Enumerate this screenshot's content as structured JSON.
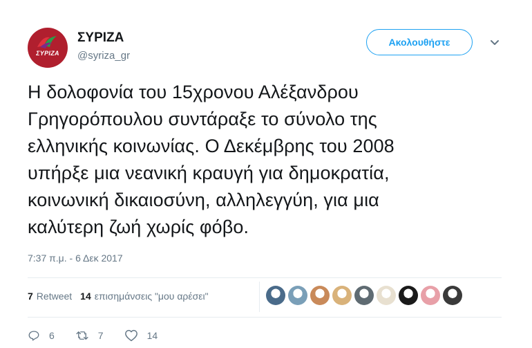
{
  "profile": {
    "name": "ΣΥΡΙΖΑ",
    "handle": "@syriza_gr",
    "avatar_text": "ΣΥΡΙΖΑ"
  },
  "follow_label": "Ακολουθήστε",
  "tweet_text": "Η δολοφονία του 15χρονου Αλέξανδρου\nΓρηγορόπουλου συντάραξε το σύνολο της\nελληνικής κοινωνίας. Ο Δεκέμβρης του 2008\nυπήρξε μια νεανική κραυγή για δημοκρατία,\nκοινωνική δικαιοσύνη, αλληλεγγύη, για μια\nκαλύτερη ζωή χωρίς φόβο.",
  "timestamp": "7:37 π.μ. - 6 Δεκ 2017",
  "stats": {
    "retweets_count": "7",
    "retweets_label": "Retweet",
    "likes_count": "14",
    "likes_label": "επισημάνσεις \"μου αρέσει\""
  },
  "likers": [
    {
      "name": "liker-1",
      "color": "#4a6b8a"
    },
    {
      "name": "liker-2",
      "color": "#7a9fb8"
    },
    {
      "name": "liker-3",
      "color": "#c98a5a"
    },
    {
      "name": "liker-4",
      "color": "#d9b27a"
    },
    {
      "name": "liker-5",
      "color": "#5f6b72"
    },
    {
      "name": "liker-6",
      "color": "#e8e0d0"
    },
    {
      "name": "liker-7",
      "color": "#1a1a1a"
    },
    {
      "name": "liker-8",
      "color": "#e8a0a8"
    },
    {
      "name": "liker-9",
      "color": "#3a3a3a"
    }
  ],
  "actions": {
    "reply_count": "6",
    "retweet_count": "7",
    "like_count": "14"
  },
  "colors": {
    "accent": "#1da1f2",
    "avatar_bg": "#b01f2e",
    "muted": "#657786"
  }
}
